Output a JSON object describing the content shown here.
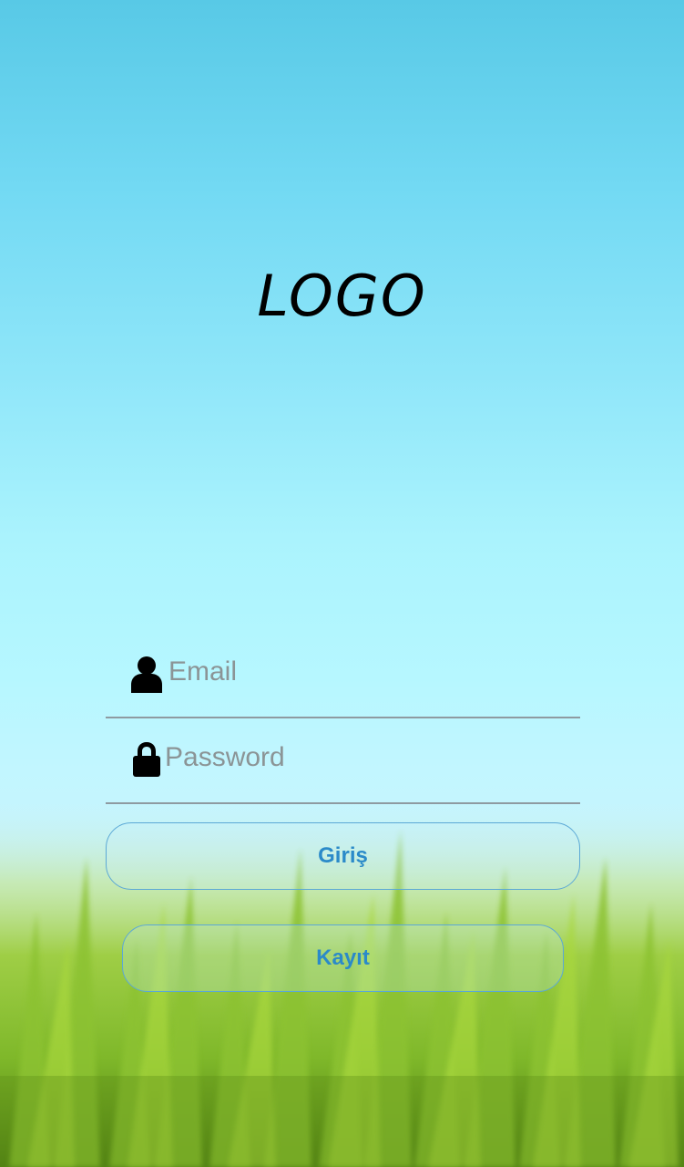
{
  "logo": {
    "text": "LOGO"
  },
  "form": {
    "email": {
      "placeholder": "Email",
      "icon": "user-icon"
    },
    "password": {
      "placeholder": "Password",
      "icon": "lock-icon"
    }
  },
  "buttons": {
    "login_label": "Giriş",
    "register_label": "Kayıt"
  },
  "colors": {
    "sky_top": "#58c9e6",
    "sky_bottom": "#cdf2f8",
    "button_text": "#2b8ac9",
    "button_border": "#5ba8d6",
    "placeholder_text": "#8b9496",
    "underline": "#8e9aa1",
    "grass": "#7fb82a"
  }
}
